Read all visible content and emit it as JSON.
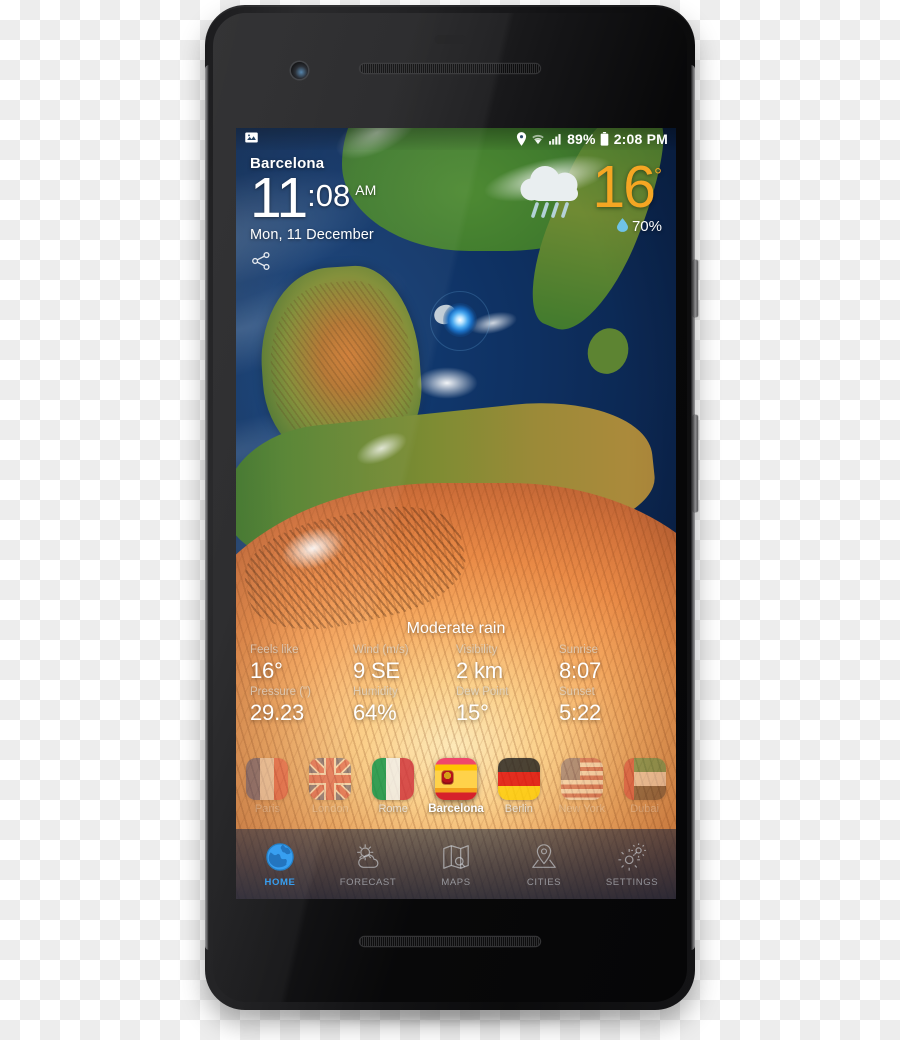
{
  "statusbar": {
    "photo_icon": "image-icon",
    "location_icon": "location-pin-icon",
    "wifi_icon": "wifi-icon",
    "signal_icon": "cellular-signal-icon",
    "battery_percent": "89%",
    "battery_icon": "battery-icon",
    "clock": "2:08 PM"
  },
  "current": {
    "city": "Barcelona",
    "clock_hour": "11",
    "clock_colon": ":",
    "clock_minute": "08",
    "clock_ampm": "AM",
    "date": "Mon, 11 December",
    "share_icon": "share-icon",
    "weather_icon": "rain-cloud-icon",
    "temperature": "16",
    "degree": "°",
    "humidity_icon": "water-drop-icon",
    "humidity": "70%",
    "accent_color": "#f5a623",
    "marker_icon": "map-location-marker"
  },
  "condition": "Moderate rain",
  "details": [
    [
      {
        "label": "Feels like",
        "value": "16°"
      },
      {
        "label": "Wind (m/s)",
        "value": "9 SE"
      },
      {
        "label": "Visibility",
        "value": "2 km"
      },
      {
        "label": "Sunrise",
        "value": "8:07"
      }
    ],
    [
      {
        "label": "Pressure (\")",
        "value": "29.23"
      },
      {
        "label": "Humidity",
        "value": "64%"
      },
      {
        "label": "Dew Point",
        "value": "15°"
      },
      {
        "label": "Sunset",
        "value": "5:22"
      }
    ]
  ],
  "cities": [
    {
      "name": "Paris",
      "flag": "flag-france",
      "state": "dim"
    },
    {
      "name": "London",
      "flag": "flag-united-kingdom",
      "state": "dim"
    },
    {
      "name": "Rome",
      "flag": "flag-italy",
      "state": "mid"
    },
    {
      "name": "Barcelona",
      "flag": "flag-spain",
      "state": "active"
    },
    {
      "name": "Berlin",
      "flag": "flag-germany",
      "state": "mid"
    },
    {
      "name": "New York",
      "flag": "flag-united-states",
      "state": "dim"
    },
    {
      "name": "Dubai",
      "flag": "flag-uae",
      "state": "dim"
    }
  ],
  "nav": [
    {
      "label": "HOME",
      "icon": "globe-icon",
      "active": true
    },
    {
      "label": "FORECAST",
      "icon": "sun-cloud-icon",
      "active": false
    },
    {
      "label": "MAPS",
      "icon": "map-icon",
      "active": false
    },
    {
      "label": "CITIES",
      "icon": "pin-base-icon",
      "active": false
    },
    {
      "label": "SETTINGS",
      "icon": "gears-icon",
      "active": false
    }
  ],
  "nav_active_color": "#2f9bf0"
}
